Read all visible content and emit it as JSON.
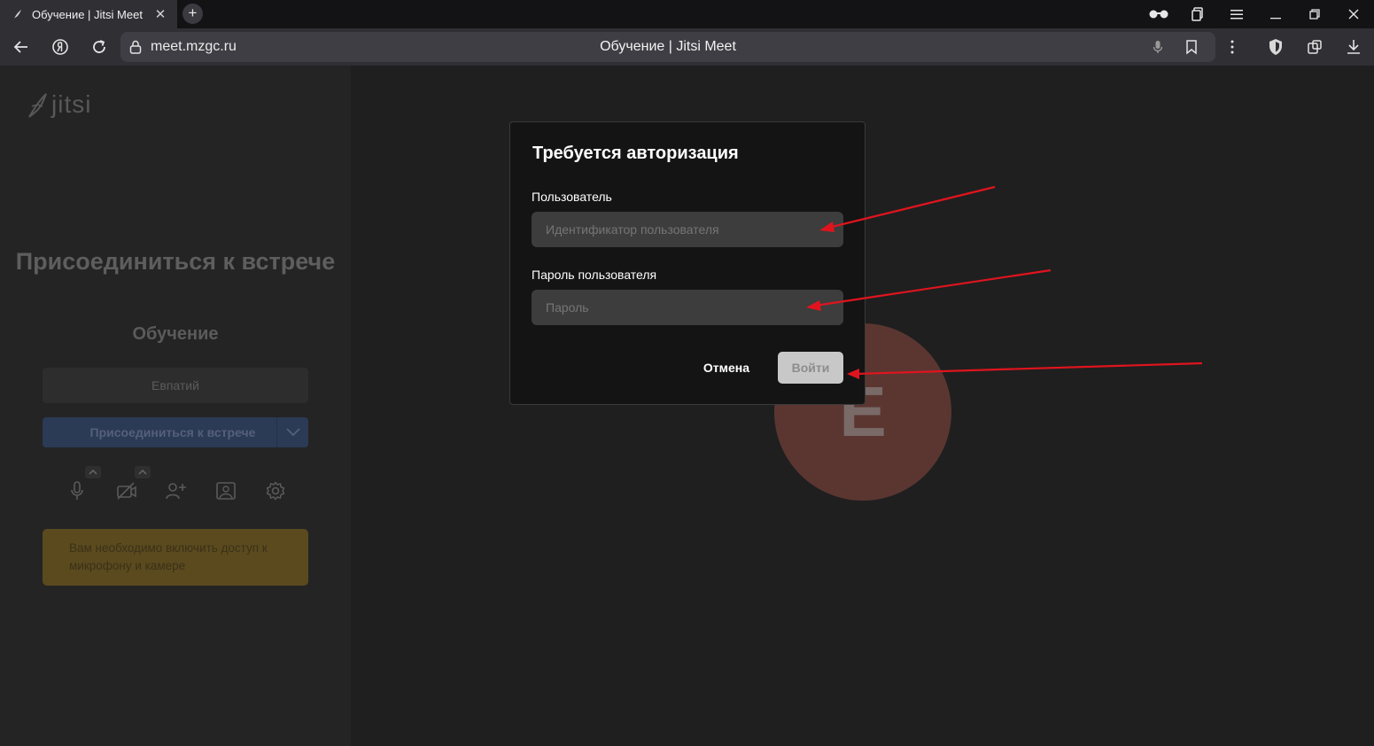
{
  "browser": {
    "tab_title": "Обучение | Jitsi Meet",
    "url": "meet.mzgc.ru",
    "page_title": "Обучение | Jitsi Meet"
  },
  "prejoin": {
    "logo_text": "jitsi",
    "heading": "Присоединиться к встрече",
    "room_name": "Обучение",
    "name_value": "Евпатий",
    "join_button": "Присоединиться к встрече",
    "warning": "Вам необходимо включить доступ к микрофону и камере",
    "avatar_letter": "E"
  },
  "dialog": {
    "title": "Требуется авторизация",
    "user_label": "Пользователь",
    "user_placeholder": "Идентификатор пользователя",
    "password_label": "Пароль пользователя",
    "password_placeholder": "Пароль",
    "cancel": "Отмена",
    "login": "Войти"
  },
  "colors": {
    "annotation_arrow": "#e0141e",
    "dialog_bg": "#141414",
    "input_bg": "#3d3d3d",
    "avatar": "#5b3631"
  }
}
